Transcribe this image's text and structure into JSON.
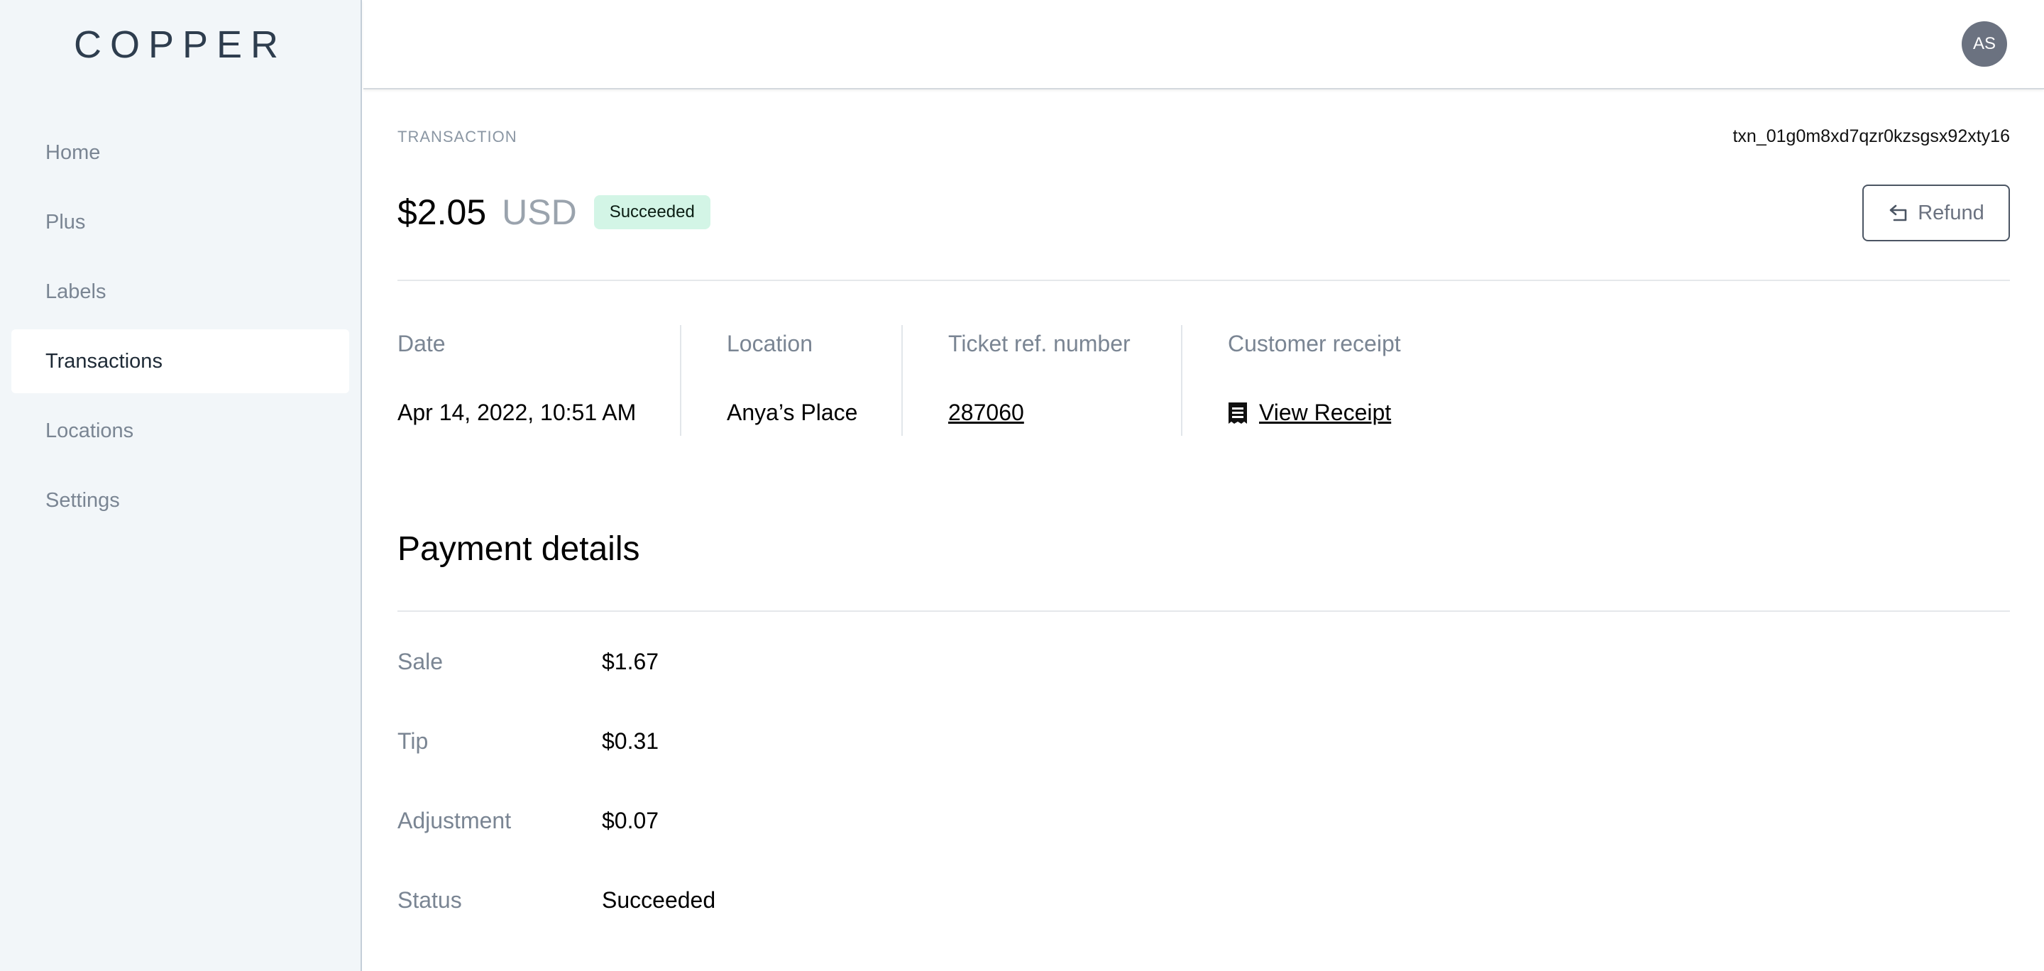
{
  "sidebar": {
    "logo": "COPPER",
    "items": [
      {
        "label": "Home"
      },
      {
        "label": "Plus"
      },
      {
        "label": "Labels"
      },
      {
        "label": "Transactions"
      },
      {
        "label": "Locations"
      },
      {
        "label": "Settings"
      }
    ],
    "active": "Transactions"
  },
  "header": {
    "avatar_initials": "AS"
  },
  "transaction": {
    "overline": "TRANSACTION",
    "id": "txn_01g0m8xd7qzr0kzsgsx92xty16",
    "amount": "$2.05",
    "currency": "USD",
    "status_badge": "Succeeded",
    "refund_label": "Refund"
  },
  "meta": {
    "date_label": "Date",
    "date_value": "Apr 14, 2022, 10:51 AM",
    "location_label": "Location",
    "location_value": "Anya’s Place",
    "ticket_label": "Ticket ref. number",
    "ticket_value": "287060",
    "receipt_label": "Customer receipt",
    "receipt_link": "View Receipt"
  },
  "payment_details": {
    "title": "Payment details",
    "rows": [
      {
        "label": "Sale",
        "value": "$1.67"
      },
      {
        "label": "Tip",
        "value": "$0.31"
      },
      {
        "label": "Adjustment",
        "value": "$0.07"
      },
      {
        "label": "Status",
        "value": "Succeeded"
      }
    ]
  },
  "colors": {
    "sidebar_bg": "#f2f6f9",
    "badge_bg": "#d3f5e6",
    "avatar_bg": "#6b7280"
  }
}
